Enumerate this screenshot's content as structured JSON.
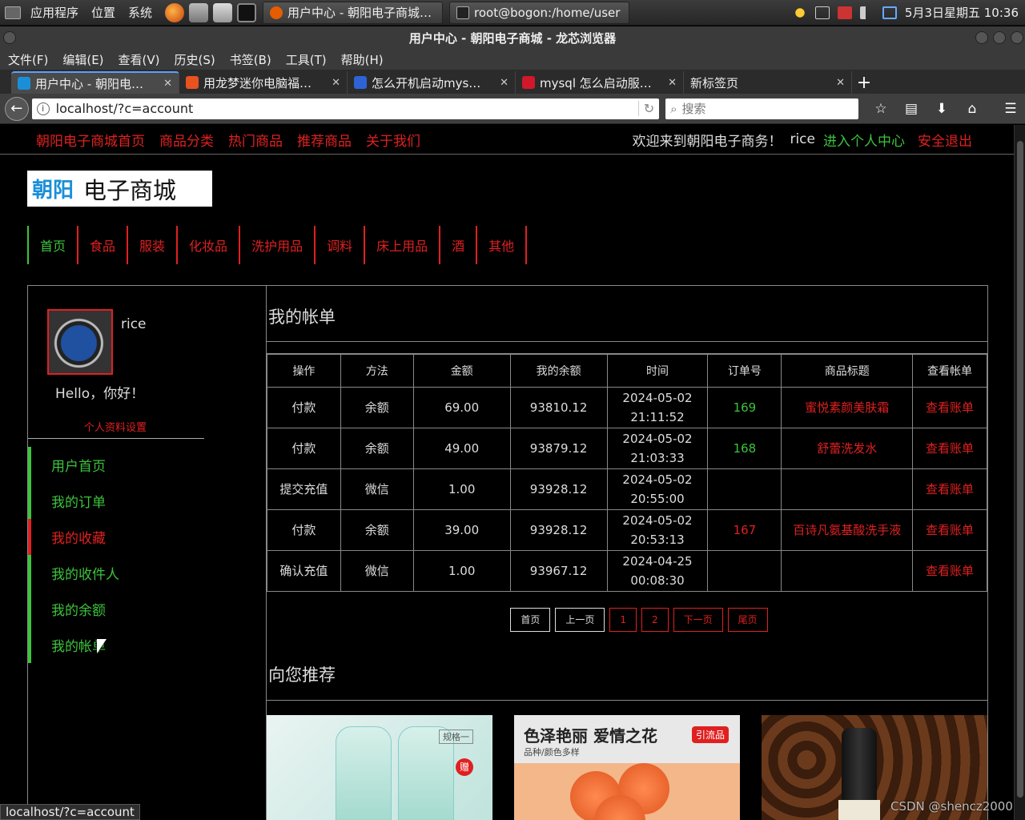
{
  "os_panel": {
    "menus": [
      "应用程序",
      "位置",
      "系统"
    ],
    "tasks": [
      "用户中心 - 朝阳电子商城…",
      "root@bogon:/home/user"
    ],
    "clock": "5月3日星期五 10:36"
  },
  "browser": {
    "title": "用户中心 - 朝阳电子商城 - 龙芯浏览器",
    "menu": [
      "文件(F)",
      "编辑(E)",
      "查看(V)",
      "历史(S)",
      "书签(B)",
      "工具(T)",
      "帮助(H)"
    ],
    "tabs": [
      {
        "label": "用户中心 - 朝阳电…",
        "favicon_color": "#1a8fd8"
      },
      {
        "label": "用龙梦迷你电脑福…",
        "favicon_color": "#e8521f"
      },
      {
        "label": "怎么开机启动mys…",
        "favicon_color": "#2e63d6"
      },
      {
        "label": "mysql 怎么启动服…",
        "favicon_color": "#d0182a"
      },
      {
        "label": "新标签页",
        "favicon_color": ""
      }
    ],
    "url": "localhost/?c=account",
    "search_placeholder": "搜索",
    "status_url": "localhost/?c=account"
  },
  "site": {
    "topnav": [
      "朝阳电子商城首页",
      "商品分类",
      "热门商品",
      "推荐商品",
      "关于我们"
    ],
    "welcome": "欢迎来到朝阳电子商务！",
    "username": "rice",
    "personal_center": "进入个人中心",
    "logout": "安全退出",
    "logo_part1": "朝阳",
    "logo_part2": "电子商城",
    "categories": [
      "首页",
      "食品",
      "服装",
      "化妆品",
      "洗护用品",
      "调料",
      "床上用品",
      "酒",
      "其他"
    ]
  },
  "sidebar": {
    "username": "rice",
    "hello": "Hello，你好！",
    "profile_settings": "个人资料设置",
    "items": [
      "用户首页",
      "我的订单",
      "我的收藏",
      "我的收件人",
      "我的余额",
      "我的帐单"
    ]
  },
  "bill": {
    "title": "我的帐单",
    "headers": [
      "操作",
      "方法",
      "金额",
      "我的余额",
      "时间",
      "订单号",
      "商品标题",
      "查看帐单"
    ],
    "rows": [
      {
        "op": "付款",
        "method": "余额",
        "amount": "69.00",
        "balance": "93810.12",
        "date": "2024-05-02",
        "time": "21:11:52",
        "order": "169",
        "order_color": "green",
        "title": "蜜悦素颜美肤霜",
        "view": "查看账单"
      },
      {
        "op": "付款",
        "method": "余额",
        "amount": "49.00",
        "balance": "93879.12",
        "date": "2024-05-02",
        "time": "21:03:33",
        "order": "168",
        "order_color": "green",
        "title": "舒蕾洗发水",
        "view": "查看账单"
      },
      {
        "op": "提交充值",
        "method": "微信",
        "amount": "1.00",
        "balance": "93928.12",
        "date": "2024-05-02",
        "time": "20:55:00",
        "order": "",
        "order_color": "",
        "title": "",
        "view": "查看账单"
      },
      {
        "op": "付款",
        "method": "余额",
        "amount": "39.00",
        "balance": "93928.12",
        "date": "2024-05-02",
        "time": "20:53:13",
        "order": "167",
        "order_color": "red",
        "title": "百诗凡氨基酸洗手液",
        "view": "查看账单"
      },
      {
        "op": "确认充值",
        "method": "微信",
        "amount": "1.00",
        "balance": "93967.12",
        "date": "2024-04-25",
        "time": "00:08:30",
        "order": "",
        "order_color": "",
        "title": "",
        "view": "查看账单"
      }
    ],
    "pager": [
      "首页",
      "上一页",
      "1",
      "2",
      "下一页",
      "尾页"
    ]
  },
  "recommend": {
    "title": "向您推荐",
    "items": [
      {
        "spec1": "规格一",
        "gift": "赠"
      },
      {
        "headline": "色泽艳丽 爱情之花",
        "sub": "品种/颜色多样",
        "badge": "引流品"
      },
      {}
    ]
  },
  "watermark": "CSDN @shencz2000"
}
